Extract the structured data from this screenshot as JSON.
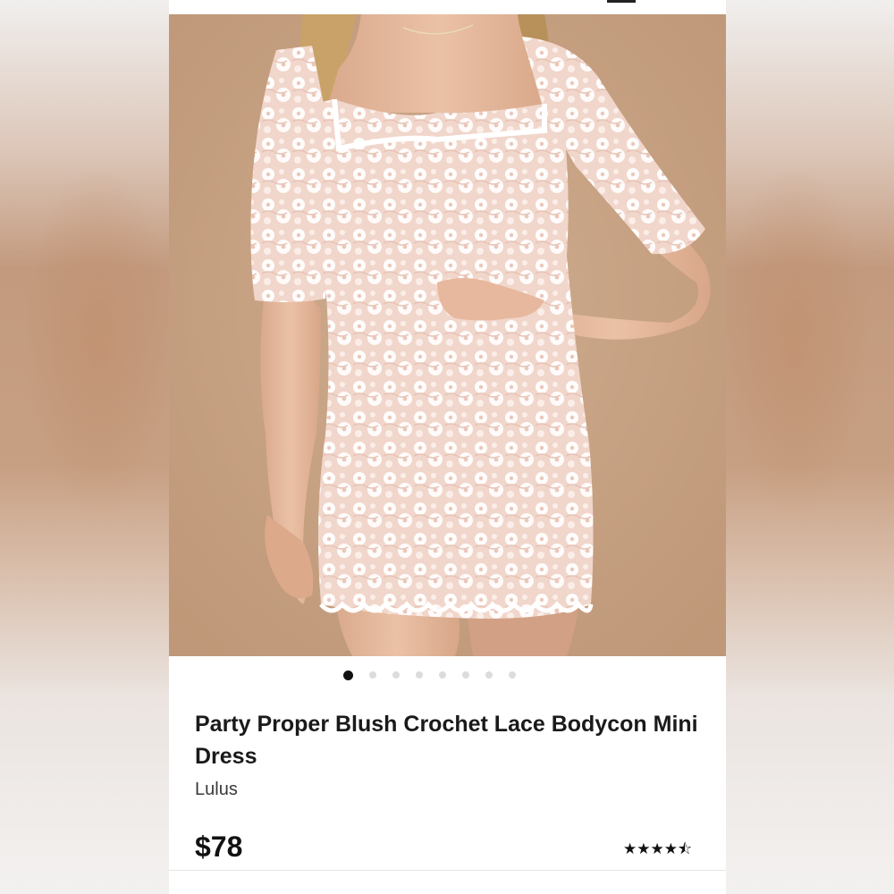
{
  "product": {
    "image_alt": "Model wearing blush crochet lace bodycon mini dress",
    "carousel": {
      "total": 8,
      "active_index": 0
    },
    "title": "Party Proper Blush Crochet Lace Bodycon Mini Dress",
    "brand": "Lulus",
    "price": "$78",
    "rating": {
      "value": 4.5,
      "max": 5,
      "stars_text": "★★★★⯪"
    }
  },
  "colors": {
    "photo_background": "#c8a485",
    "dress": "#f3ddd3",
    "lace": "#ffffff"
  }
}
